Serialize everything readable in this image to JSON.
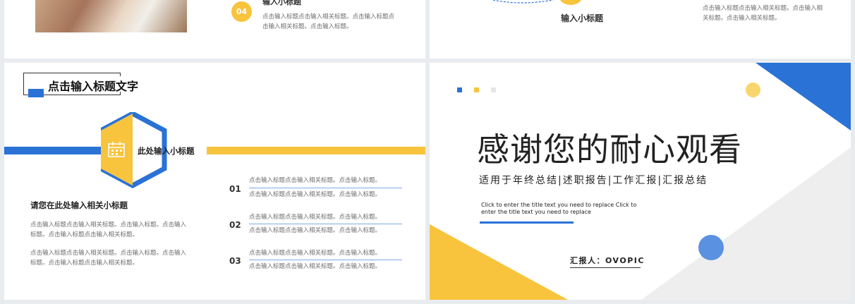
{
  "top_left": {
    "number": "04",
    "subtitle": "输入小标题",
    "text_line1": "点击输入标题点击输入相关标题。点击输入标题点",
    "text_line2": "击输入相关标题。点击输入标题。"
  },
  "top_right": {
    "subtitle": "输入小标题",
    "text_line1": "点击输入标题点击输入相关标题。点击输入相",
    "text_line2": "关标题。点击输入相关标题。"
  },
  "bottom_left": {
    "title": "点击输入标题文字",
    "hex_label": "此处输入小标题",
    "sub_heading": "请您在此处输入相关小标题",
    "para1_line1": "点击输入标题点击输入相关标题。点击输入标题。点击输入",
    "para1_line2": "标题。点击输入标题点击输入相关标题。",
    "para2_line1": "点击输入标题点击输入相关标题。点击输入标题。点击输入",
    "para2_line2": "标题。点击输入标题点击输入相关标题。",
    "items": [
      {
        "num": "01",
        "line1": "点击输入标题点击输入相关标题。点击输入标题。",
        "line2": "点击输入标题点击输入相关标题。点击输入标题。"
      },
      {
        "num": "02",
        "line1": "点击输入标题点击输入相关标题。点击输入标题。",
        "line2": "点击输入标题点击输入相关标题。点击输入标题。"
      },
      {
        "num": "03",
        "line1": "点击输入标题点击输入相关标题。点击输入标题。",
        "line2": "点击输入标题点击输入相关标题。点击输入标题。"
      }
    ]
  },
  "bottom_right": {
    "main_title": "感谢您的耐心观看",
    "subtitle": "适用于年终总结|述职报告|工作汇报|汇报总结",
    "english_line1": "Click to enter the title text you need to replace Click to",
    "english_line2": "enter the title text you need to replace",
    "reporter": "汇报人：OVOPIC"
  },
  "colors": {
    "blue": "#2a72d5",
    "yellow": "#f8c43e",
    "light_blue_circle": "#5a91e0",
    "light_yellow_circle": "#f9d56e",
    "gray_band": "#eeeeee"
  }
}
